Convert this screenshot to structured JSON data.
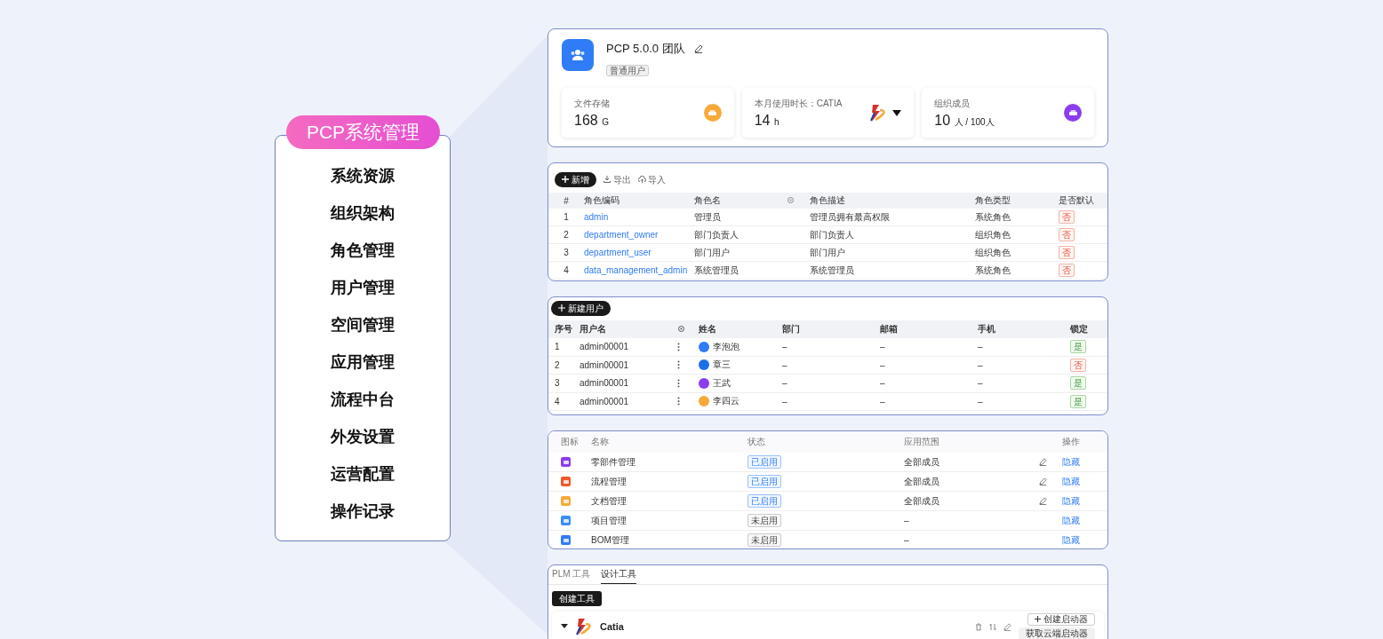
{
  "menu": {
    "title": "PCP系统管理",
    "items": [
      {
        "label": "系统资源"
      },
      {
        "label": "组织架构"
      },
      {
        "label": "角色管理"
      },
      {
        "label": "用户管理"
      },
      {
        "label": "空间管理"
      },
      {
        "label": "应用管理"
      },
      {
        "label": "流程中台"
      },
      {
        "label": "外发设置"
      },
      {
        "label": "运营配置"
      },
      {
        "label": "操作记录"
      }
    ]
  },
  "team": {
    "name": "PCP 5.0.0 团队",
    "tag": "普通用户",
    "stats": [
      {
        "kind": "storage",
        "label": "文件存储",
        "value": "168",
        "unit": "G"
      },
      {
        "kind": "usage",
        "label": "本月使用时长：CATIA",
        "value": "14",
        "unit": "h"
      },
      {
        "kind": "members",
        "label": "组织成员",
        "value": "10",
        "unit": "人 / 100人"
      }
    ]
  },
  "roles": {
    "add": "新增",
    "export": "导出",
    "import": "导入",
    "columns": [
      "#",
      "角色编码",
      "角色名",
      "角色描述",
      "角色类型",
      "是否默认"
    ],
    "rows": [
      {
        "index": "1",
        "code": "admin",
        "name": "管理员",
        "description": "管理员拥有最高权限",
        "type": "系统角色",
        "default_text": "否",
        "is_default": false
      },
      {
        "index": "2",
        "code": "department_owner",
        "name": "部门负责人",
        "description": "部门负责人",
        "type": "组织角色",
        "default_text": "否",
        "is_default": false
      },
      {
        "index": "3",
        "code": "department_user",
        "name": "部门用户",
        "description": "部门用户",
        "type": "组织角色",
        "default_text": "否",
        "is_default": false
      },
      {
        "index": "4",
        "code": "data_management_admin",
        "name": "系统管理员",
        "description": "系统管理员",
        "type": "系统角色",
        "default_text": "否",
        "is_default": false
      }
    ]
  },
  "users": {
    "add": "新建用户",
    "columns": [
      "序号",
      "用户名",
      "姓名",
      "部门",
      "邮箱",
      "手机",
      "锁定"
    ],
    "rows": [
      {
        "index": "1",
        "username": "admin00001",
        "name": "李泡泡",
        "color": "#2f7cf6",
        "department": "–",
        "email": "–",
        "phone": "–",
        "lock_text": "是",
        "locked": true
      },
      {
        "index": "2",
        "username": "admin00001",
        "name": "章三",
        "color": "#1d6fe8",
        "department": "–",
        "email": "–",
        "phone": "–",
        "lock_text": "否",
        "locked": false
      },
      {
        "index": "3",
        "username": "admin00001",
        "name": "王武",
        "color": "#8b3cf0",
        "department": "–",
        "email": "–",
        "phone": "–",
        "lock_text": "是",
        "locked": true
      },
      {
        "index": "4",
        "username": "admin00001",
        "name": "李四云",
        "color": "#f7a93a",
        "department": "–",
        "email": "–",
        "phone": "–",
        "lock_text": "是",
        "locked": true
      }
    ]
  },
  "apps": {
    "columns": [
      "图标",
      "名称",
      "状态",
      "应用范围",
      "操作"
    ],
    "rows": [
      {
        "color": "#8b3cf0",
        "name": "零部件管理",
        "status": "已启用",
        "enabled": true,
        "scope": "全部成员",
        "editable": true,
        "action": "隐藏"
      },
      {
        "color": "#f0582a",
        "name": "流程管理",
        "status": "已启用",
        "enabled": true,
        "scope": "全部成员",
        "editable": true,
        "action": "隐藏"
      },
      {
        "color": "#f7a93a",
        "name": "文档管理",
        "status": "已启用",
        "enabled": true,
        "scope": "全部成员",
        "editable": true,
        "action": "隐藏"
      },
      {
        "color": "#3b8cf5",
        "name": "项目管理",
        "status": "未启用",
        "enabled": false,
        "scope": "–",
        "editable": false,
        "action": "隐藏"
      },
      {
        "color": "#2f7cf6",
        "name": "BOM管理",
        "status": "未启用",
        "enabled": false,
        "scope": "–",
        "editable": false,
        "action": "隐藏"
      }
    ]
  },
  "tools": {
    "tabs": [
      {
        "label": "PLM 工具",
        "selected": false
      },
      {
        "label": "设计工具",
        "selected": true
      }
    ],
    "create": "创建工具",
    "tool": {
      "name": "Catia",
      "expanded": true,
      "create_launcher": "创建启动器",
      "cloud_launcher": "获取云端启动器"
    }
  }
}
